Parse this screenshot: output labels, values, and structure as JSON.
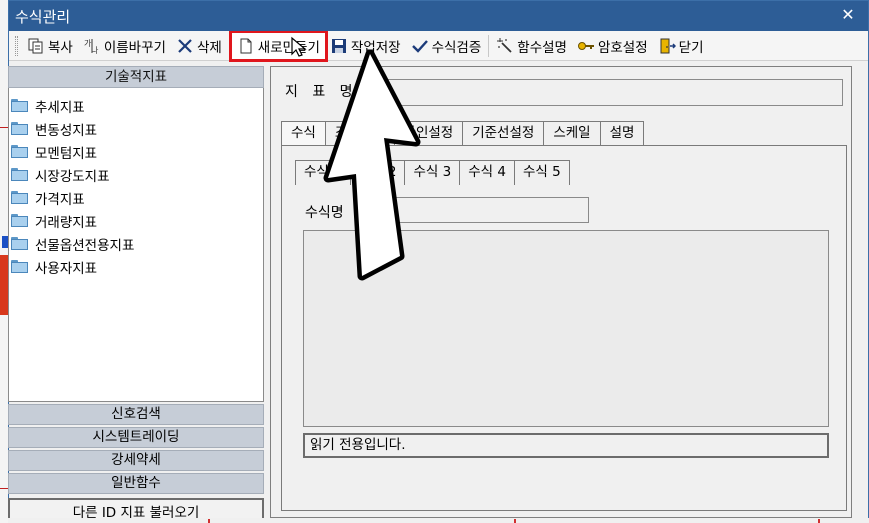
{
  "window": {
    "title": "수식관리",
    "close_glyph": "✕"
  },
  "toolbar": {
    "items": [
      {
        "label": "복사",
        "icon": "copy-icon"
      },
      {
        "label": "이름바꾸기",
        "icon": "rename-icon"
      },
      {
        "label": "삭제",
        "icon": "delete-icon"
      },
      {
        "label": "새로만들기",
        "icon": "new-document-icon"
      },
      {
        "label": "작업저장",
        "icon": "save-icon"
      },
      {
        "label": "수식검증",
        "icon": "check-icon"
      },
      {
        "label": "함수설명",
        "icon": "magic-wand-icon"
      },
      {
        "label": "암호설정",
        "icon": "key-icon"
      },
      {
        "label": "닫기",
        "icon": "exit-door-icon"
      }
    ],
    "highlight_color": "#e0161d"
  },
  "left_panel": {
    "header": "기술적지표",
    "tree_items": [
      "추세지표",
      "변동성지표",
      "모멘텀지표",
      "시장강도지표",
      "가격지표",
      "거래량지표",
      "선물옵션전용지표",
      "사용자지표"
    ],
    "groups": [
      "신호검색",
      "시스템트레이딩",
      "강세약세",
      "일반함수"
    ],
    "load_button": "다른 ID 지표 불러오기"
  },
  "right_panel": {
    "name_label": "지 표 명",
    "tabs": [
      "수식",
      "조건설정",
      "라인설정",
      "기준선설정",
      "스케일",
      "설명"
    ],
    "formula_tabs": [
      "수식 1",
      "수식 2",
      "수식 3",
      "수식 4",
      "수식 5"
    ],
    "formula_label": "수식명",
    "status_text": "읽기 전용입니다."
  }
}
